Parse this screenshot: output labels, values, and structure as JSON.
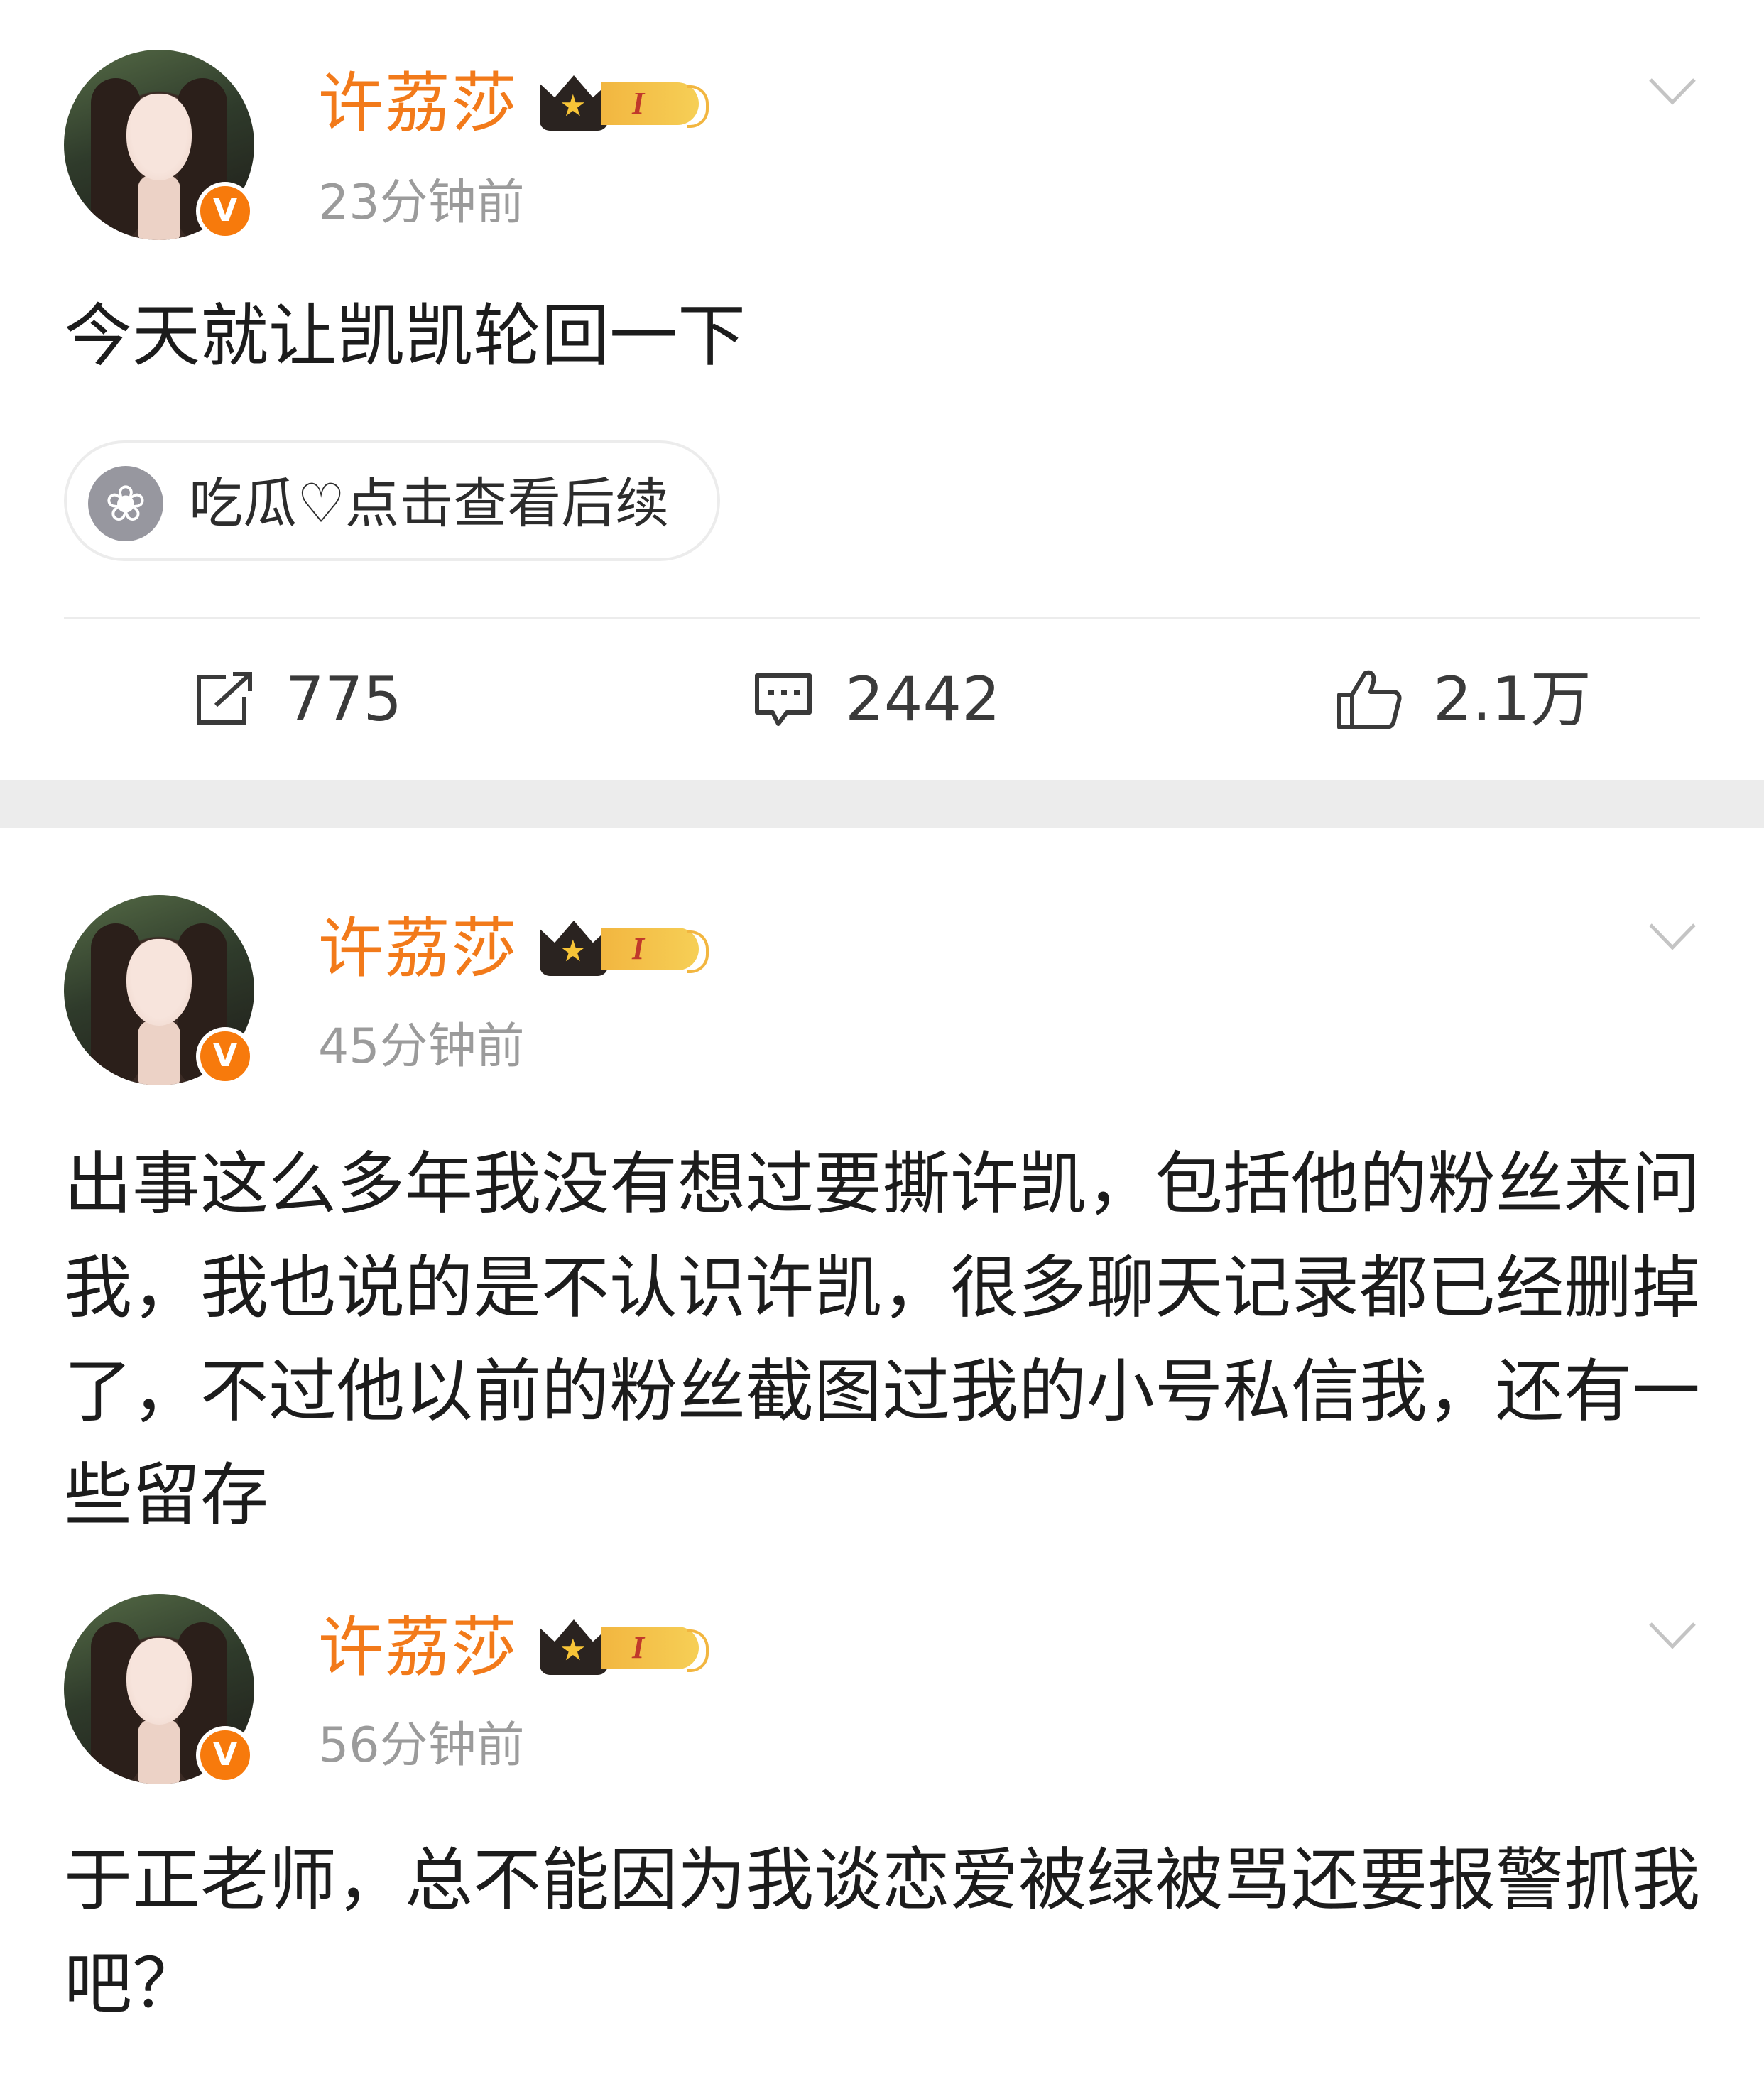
{
  "posts": [
    {
      "author": "许荔莎",
      "badge_level": "I",
      "time": "23分钟前",
      "text": "今天就让凯凯轮回一下",
      "verified_mark": "V",
      "topic": {
        "icon": "topic-flower-icon",
        "label": "吃瓜♡点击查看后续"
      },
      "actions": {
        "repost_count": "775",
        "comment_count": "2442",
        "like_count": "2.1万"
      }
    },
    {
      "author": "许荔莎",
      "badge_level": "I",
      "time": "45分钟前",
      "verified_mark": "V",
      "text": "出事这么多年我没有想过要撕许凯，包括他的粉丝来问我，我也说的是不认识许凯，很多聊天记录都已经删掉了，不过他以前的粉丝截图过我的小号私信我，还有一些留存"
    },
    {
      "author": "许荔莎",
      "badge_level": "I",
      "time": "56分钟前",
      "verified_mark": "V",
      "text": "于正老师，总不能因为我谈恋爱被绿被骂还要报警抓我吧？"
    }
  ],
  "colors": {
    "author_name": "#f27a1a",
    "verified": "#f77a0c",
    "time": "#9b9b9b",
    "text": "#1c1c1c",
    "separator": "#ececec"
  }
}
